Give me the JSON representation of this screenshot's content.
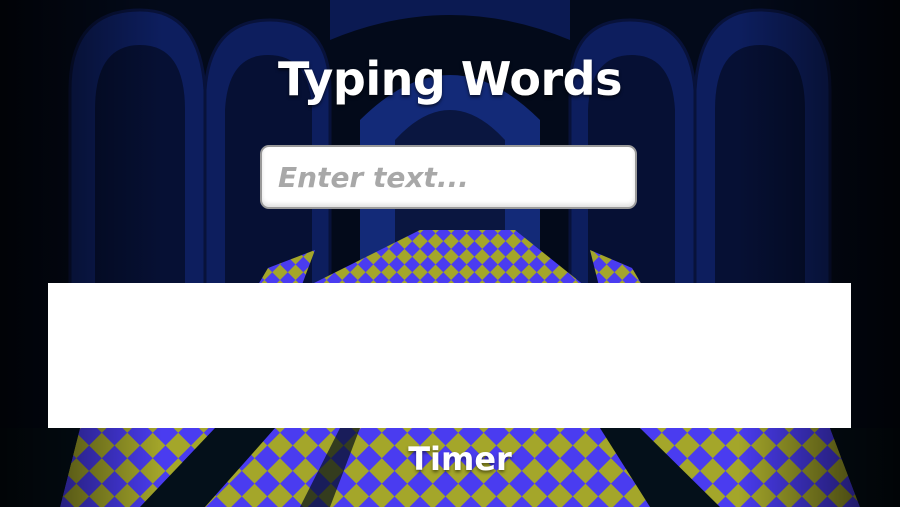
{
  "game": {
    "title": "Typing Words",
    "input_placeholder": "Enter text...",
    "input_value": "",
    "words_panel_text": "",
    "timer_label": "Timer"
  },
  "scene": {
    "sky_color": "#030a1a",
    "arch_color": "#0d1e5e",
    "floor_color": "#4a3cf0",
    "tile_color": "#a4a62a",
    "pillar_color": "#04101a"
  }
}
